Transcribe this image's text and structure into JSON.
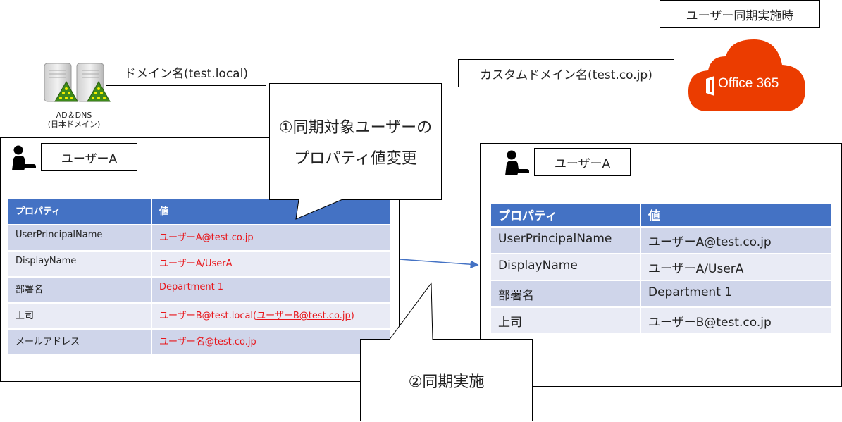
{
  "header": {
    "sync_time_label": "ユーザー同期実施時"
  },
  "on_prem": {
    "domain_label": "ドメイン名(test.local)",
    "server_caption_line1": "AD＆DNS",
    "server_caption_line2": "(日本ドメイン)",
    "user_label": "ユーザーA",
    "table": {
      "headers": [
        "プロパティ",
        "値"
      ],
      "rows": [
        {
          "property": "UserPrincipalName",
          "value": "ユーザーA@test.co.jp"
        },
        {
          "property": "DisplayName",
          "value": "ユーザーA/UserA"
        },
        {
          "property": "部署名",
          "value": "Department 1"
        },
        {
          "property": "上司",
          "value": "ユーザーB@test.local(",
          "value_link": "ユーザーB@test.co.jp",
          "value_suffix": ")"
        },
        {
          "property": "メールアドレス",
          "value": "ユーザー名@test.co.jp"
        }
      ]
    }
  },
  "cloud": {
    "custom_domain_label": "カスタムドメイン名(test.co.jp)",
    "logo_text": "Office 365",
    "brand_color": "#eb3c00",
    "user_label": "ユーザーA",
    "table": {
      "headers": [
        "プロパティ",
        "値"
      ],
      "rows": [
        {
          "property": "UserPrincipalName",
          "value": "ユーザーA@test.co.jp"
        },
        {
          "property": "DisplayName",
          "value": "ユーザーA/UserA"
        },
        {
          "property": "部署名",
          "value": "Department 1"
        },
        {
          "property": "上司",
          "value": "ユーザーB@test.co.jp"
        }
      ]
    }
  },
  "callouts": {
    "step1_line1": "①同期対象ユーザーの",
    "step1_line2": "プロパティ値変更",
    "step2": "②同期実施"
  },
  "colors": {
    "header_blue": "#4472c4",
    "changed_value_red": "#e8161b",
    "arrow_blue": "#4472c4"
  }
}
